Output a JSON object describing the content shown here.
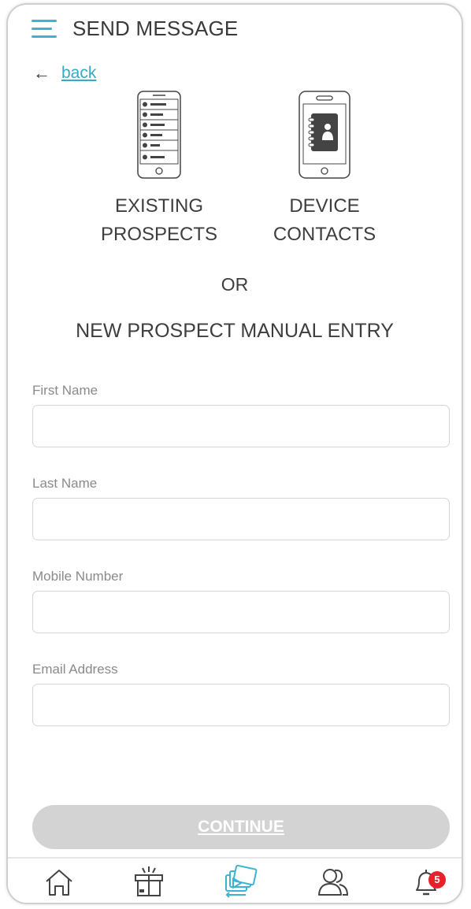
{
  "header": {
    "title": "SEND MESSAGE",
    "menu_icon": "hamburger-menu-icon"
  },
  "back": {
    "arrow_icon": "arrow-left-icon",
    "label": "back"
  },
  "choices": {
    "existing": {
      "icon": "prospect-list-phone-icon",
      "label": "EXISTING\nPROSPECTS"
    },
    "device": {
      "icon": "phone-contacts-book-icon",
      "label": "DEVICE\nCONTACTS"
    }
  },
  "or_text": "OR",
  "manual_title": "NEW PROSPECT MANUAL ENTRY",
  "form": {
    "first_name": {
      "label": "First Name",
      "value": "",
      "placeholder": ""
    },
    "last_name": {
      "label": "Last Name",
      "value": "",
      "placeholder": ""
    },
    "mobile": {
      "label": "Mobile Number",
      "value": "",
      "placeholder": ""
    },
    "email": {
      "label": "Email Address",
      "value": "",
      "placeholder": ""
    }
  },
  "continue_label": "CONTINUE",
  "tabbar": {
    "home_icon": "home-icon",
    "gift_icon": "gift-box-icon",
    "media_icon": "media-messages-icon",
    "people_icon": "people-icon",
    "bell_icon": "bell-icon",
    "notification_count": "5",
    "active_color": "#3ab4cf",
    "badge_color": "#e8202a"
  },
  "colors": {
    "accent": "#3ab4cf",
    "link": "#35a9c6",
    "button_disabled": "#d3d3d3"
  }
}
